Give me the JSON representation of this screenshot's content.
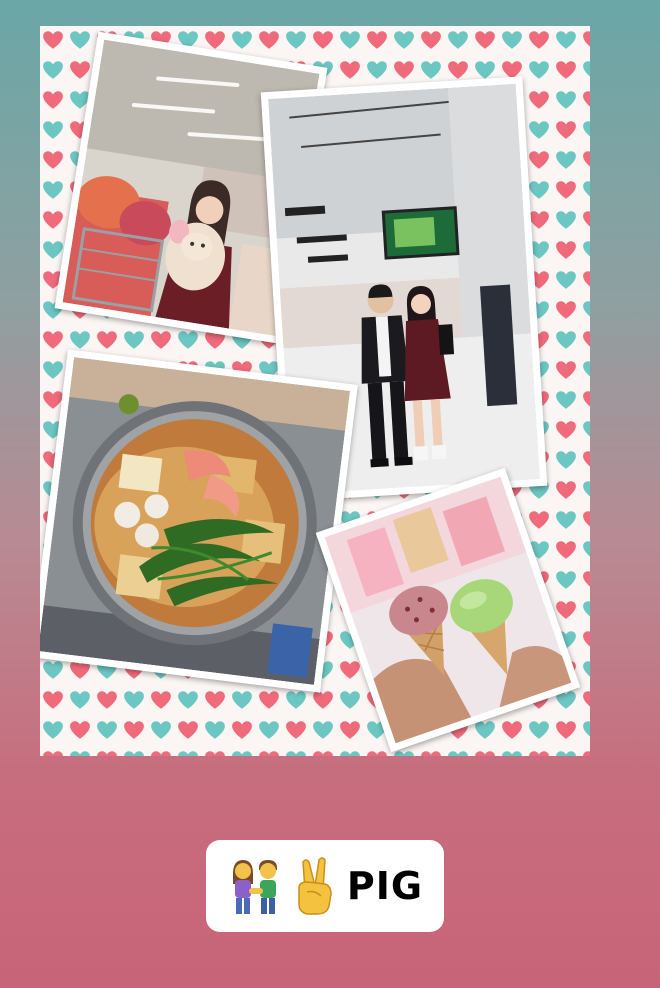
{
  "story": {
    "caption_text": "PIG",
    "caption_emoji": [
      "couple-holding-hands-icon",
      "victory-hand-icon"
    ]
  },
  "collage": {
    "background_pattern": "hearts-icon",
    "heart_colors": [
      "#ef6b7c",
      "#6cc6c2"
    ],
    "photos": [
      "plush-toy-store-photo",
      "couple-in-store-photo",
      "hot-pot-photo",
      "ice-cream-cones-photo"
    ]
  },
  "colors": {
    "gradient_top": "#6aa7a6",
    "gradient_bottom": "#c86478",
    "caption_bg": "#ffffff"
  }
}
